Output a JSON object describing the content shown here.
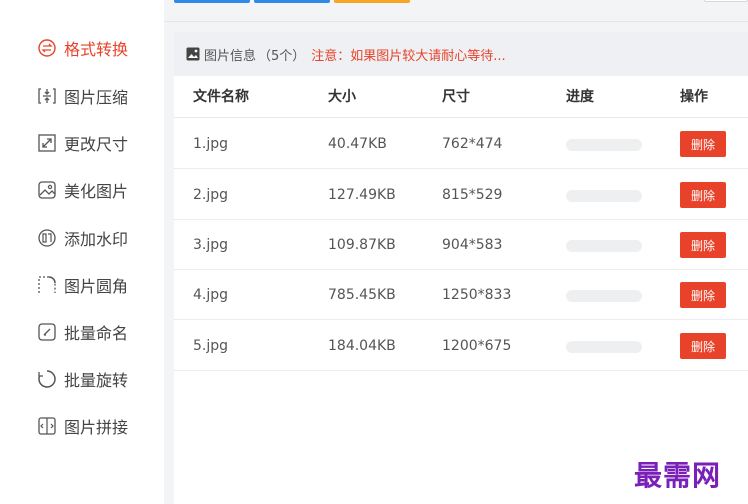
{
  "sidebar": {
    "items": [
      {
        "label": "格式转换",
        "icon": "format-convert-icon",
        "active": true
      },
      {
        "label": "图片压缩",
        "icon": "compress-icon",
        "active": false
      },
      {
        "label": "更改尺寸",
        "icon": "resize-icon",
        "active": false
      },
      {
        "label": "美化图片",
        "icon": "beautify-icon",
        "active": false
      },
      {
        "label": "添加水印",
        "icon": "watermark-icon",
        "active": false
      },
      {
        "label": "图片圆角",
        "icon": "rounded-corner-icon",
        "active": false
      },
      {
        "label": "批量命名",
        "icon": "rename-icon",
        "active": false
      },
      {
        "label": "批量旋转",
        "icon": "rotate-icon",
        "active": false
      },
      {
        "label": "图片拼接",
        "icon": "splice-icon",
        "active": false
      }
    ]
  },
  "info": {
    "title": "图片信息",
    "count": "（5个）",
    "warning": "注意：如果图片较大请耐心等待..."
  },
  "table": {
    "columns": [
      "文件名称",
      "大小",
      "尺寸",
      "进度",
      "操作"
    ],
    "rows": [
      {
        "name": "1.jpg",
        "size": "40.47KB",
        "dims": "762*474",
        "progress": 0,
        "action": "删除"
      },
      {
        "name": "2.jpg",
        "size": "127.49KB",
        "dims": "815*529",
        "progress": 0,
        "action": "删除"
      },
      {
        "name": "3.jpg",
        "size": "109.87KB",
        "dims": "904*583",
        "progress": 0,
        "action": "删除"
      },
      {
        "name": "4.jpg",
        "size": "785.45KB",
        "dims": "1250*833",
        "progress": 0,
        "action": "删除"
      },
      {
        "name": "5.jpg",
        "size": "184.04KB",
        "dims": "1200*675",
        "progress": 0,
        "action": "删除"
      }
    ]
  },
  "watermark": "最需网",
  "colors": {
    "accent": "#e8432a",
    "toolbar_blue": "#2f8ae8",
    "toolbar_orange": "#f5a623",
    "watermark": "#7a1fb8"
  }
}
